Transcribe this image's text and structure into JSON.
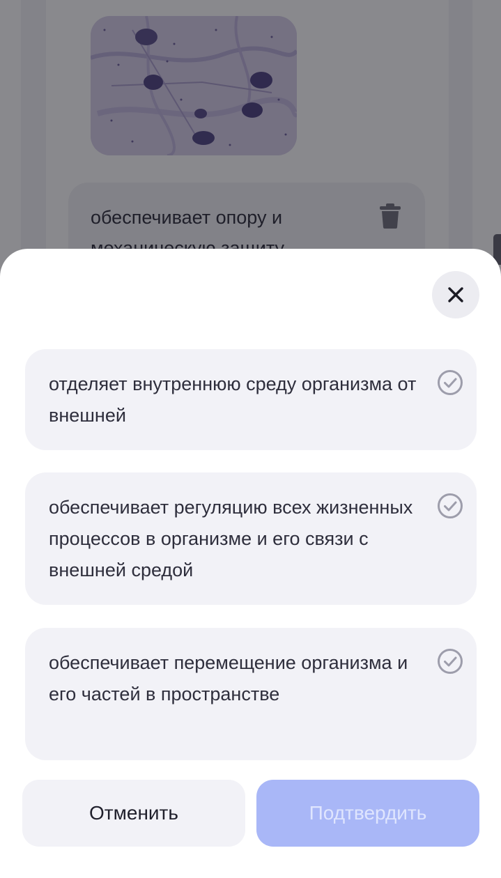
{
  "background": {
    "image": "microscope-neurons-photo",
    "answer_text": "обеспечивает опору и механическую защиту"
  },
  "modal": {
    "close_icon": "close-icon",
    "options": [
      {
        "text": "отделяет внутреннюю среду организма от внешней"
      },
      {
        "text": "обеспечивает регуляцию всех жизненных процессов в организме и его связи с внешней средой"
      },
      {
        "text": "обеспечивает перемещение организма и его частей в пространстве"
      }
    ],
    "cancel_label": "Отменить",
    "confirm_label": "Подтвердить"
  },
  "colors": {
    "accent_disabled": "#a9b7f7",
    "card_bg": "#f2f2f7",
    "check_icon": "#9d9dab"
  }
}
